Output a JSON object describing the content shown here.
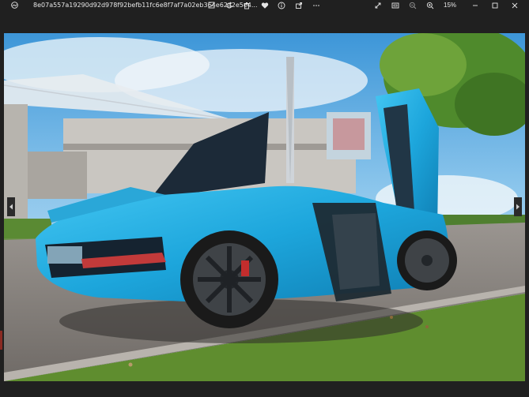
{
  "window": {
    "title": "8e07a557a19290d92d978f92befb11fc6e8f7af7a02eb364e62a2e5e4...",
    "zoom": "15%"
  },
  "toolbar": {
    "left_icons": [
      "edit-icon",
      "rotate-icon",
      "delete-icon",
      "favorite-icon",
      "info-icon",
      "share-icon",
      "more-icon"
    ],
    "right_icons": [
      "fullscreen-icon",
      "fit-icon",
      "zoom-out-icon",
      "zoom-in-icon"
    ],
    "window_controls": [
      "minimize-icon",
      "maximize-icon",
      "close-icon"
    ]
  },
  "image": {
    "subject": "blue sports car with open doors",
    "accent_color": "#19a7d9"
  },
  "colors": {
    "chrome_bg": "#202020",
    "car_blue": "#1ea9de",
    "sky_blue": "#6fb9e6",
    "grass_green": "#5a8b2f"
  }
}
